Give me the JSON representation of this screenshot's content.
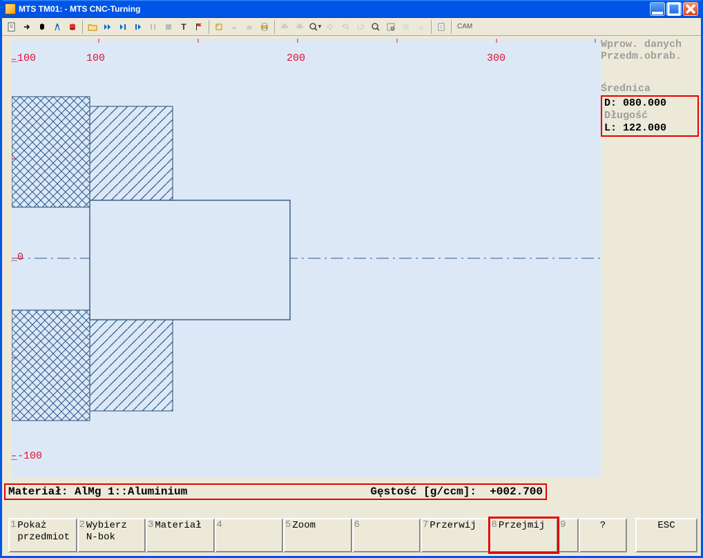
{
  "window": {
    "title": "MTS TM01:  - MTS CNC-Turning"
  },
  "toolbar": {
    "cam": "CAM"
  },
  "canvas": {
    "xticks": [
      "100",
      "200",
      "300"
    ],
    "yticks_top": "100",
    "yticks_zero": "0",
    "yticks_bottom": "-100"
  },
  "rpanel": {
    "hdr1": "Wprow. danych",
    "hdr2": "Przedm.obrab.",
    "lbl_diam": "Średnica",
    "d_label": "D:",
    "d_value": "080.000",
    "lbl_len": "Długość",
    "l_label": "L:",
    "l_value": "122.000"
  },
  "matbar": {
    "mat_label": "Materiał:",
    "mat_value": "AlMg 1::Aluminium",
    "dens_label": "Gęstość [g/ccm]:",
    "dens_value": "+002.700"
  },
  "fkeys": {
    "f1n": "1",
    "f1": "Pokaż\nprzedmiot",
    "f2n": "2",
    "f2": "Wybierz\nN-bok",
    "f3n": "3",
    "f3": "Materiał",
    "f4n": "4",
    "f4": "",
    "f5n": "5",
    "f5": "Zoom",
    "f6n": "6",
    "f6": "",
    "f7n": "7",
    "f7": "Przerwij",
    "f8n": "8",
    "f8": "Przejmij",
    "f9n": "9",
    "f9": "",
    "help": "?",
    "esc": "ESC"
  }
}
